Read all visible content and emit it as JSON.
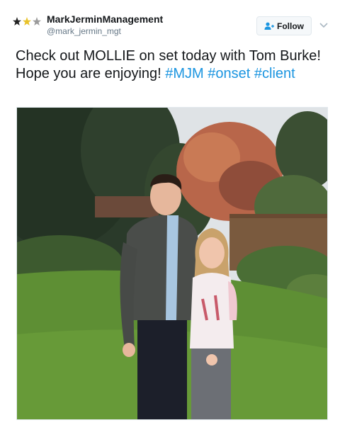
{
  "account": {
    "display_name": "MarkJerminManagement",
    "handle": "@mark_jermin_mgt",
    "avatar_icon": "three-stars-logo"
  },
  "follow_button": {
    "label": "Follow",
    "icon": "add-user-icon"
  },
  "menu": {
    "icon": "chevron-down-icon"
  },
  "tweet": {
    "text_lead": "Check out MOLLIE on set today with Tom Burke! Hope you are enjoying! ",
    "hashtags": [
      "#MJM",
      "#onset",
      "#client"
    ]
  },
  "photo": {
    "subject": "man-and-girl-in-garden"
  },
  "colors": {
    "link": "#1b95e0",
    "text": "#14171a",
    "muted": "#657786"
  }
}
